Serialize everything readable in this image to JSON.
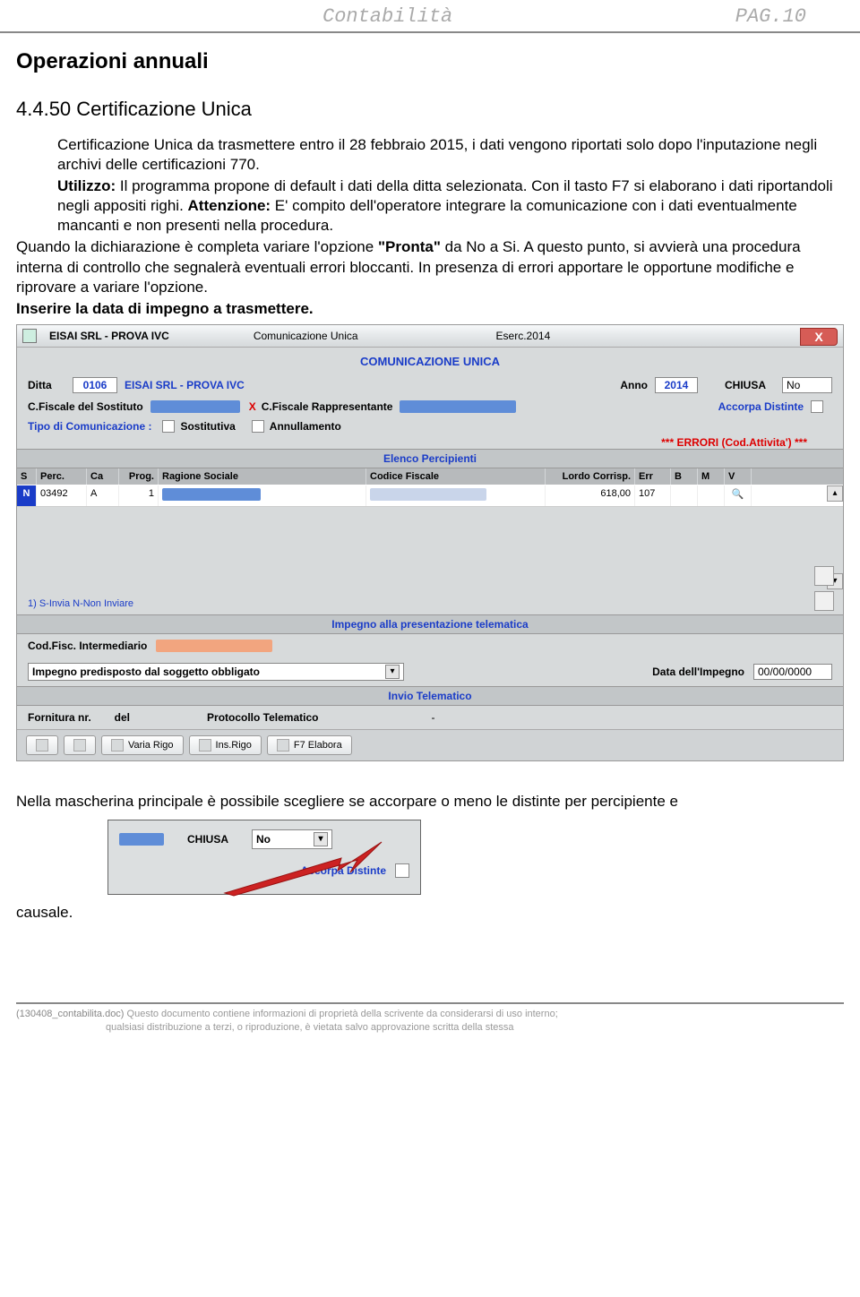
{
  "header": {
    "left": "Contabilità",
    "right": "PAG.10"
  },
  "h1": "Operazioni annuali",
  "h2": "4.4.50 Certificazione Unica",
  "para1": "Certificazione Unica da trasmettere entro il 28 febbraio 2015, i dati vengono riportati solo dopo l'inputazione negli archivi delle certificazioni 770.",
  "para2_a": "Utilizzo:",
  "para2_b": " Il programma propone di default i dati della ditta selezionata. Con il tasto F7 si elaborano i dati riportandoli negli appositi righi. ",
  "para2_c": "Attenzione:",
  "para2_d": " E' compito dell'operatore integrare la comunicazione con i dati eventualmente mancanti e non presenti nella procedura.",
  "para3_a": "Quando la dichiarazione è completa variare l'opzione ",
  "para3_b": "\"Pronta\"",
  "para3_c": " da No a Si. A questo punto, si avvierà una procedura interna di controllo che segnalerà eventuali errori bloccanti. In presenza di errori apportare le opportune modifiche e riprovare a variare l'opzione.",
  "para4": "Inserire la data di impegno a trasmettere.",
  "window": {
    "titlebar": {
      "company": "EISAI SRL - PROVA IVC",
      "center": "Comunicazione Unica",
      "eserc": "Eserc.2014"
    },
    "title": "COMUNICAZIONE UNICA",
    "ditta_label": "Ditta",
    "ditta_code": "0106",
    "ditta_name": "EISAI SRL - PROVA IVC",
    "anno_label": "Anno",
    "anno": "2014",
    "chiusa_label": "CHIUSA",
    "chiusa_val": "No",
    "cf_sost_label": "C.Fiscale del Sostituto",
    "cf_rapp_label": "C.Fiscale Rappresentante",
    "accorpa_label": "Accorpa Distinte",
    "tipo_label": "Tipo di Comunicazione :",
    "sostitutiva": "Sostitutiva",
    "annullamento": "Annullamento",
    "errori": "*** ERRORI (Cod.Attivita') ***",
    "elenco": "Elenco Percipienti",
    "cols": {
      "s": "S",
      "perc": "Perc.",
      "ca": "Ca",
      "prog": "Prog.",
      "rag": "Ragione Sociale",
      "cf": "Codice Fiscale",
      "lc": "Lordo Corrisp.",
      "err": "Err",
      "b": "B",
      "m": "M",
      "v": "V"
    },
    "row": {
      "s": "N",
      "perc": "03492",
      "ca": "A",
      "prog": "1",
      "lc": "618,00",
      "err": "107"
    },
    "hint": "1) S-Invia   N-Non Inviare",
    "impegno_header": "Impegno alla presentazione telematica",
    "codfisc_label": "Cod.Fisc. Intermediario",
    "impegno_combo": "Impegno predisposto dal soggetto obbligato",
    "data_impegno_label": "Data dell'Impegno",
    "data_impegno": "00/00/0000",
    "invio_header": "Invio Telematico",
    "fornitura_label": "Fornitura nr.",
    "del_label": "del",
    "protocollo_label": "Protocollo Telematico",
    "dash": "-",
    "buttons": {
      "b1": " ",
      "b2": " ",
      "b3": "Varia Rigo",
      "b4": "Ins.Rigo",
      "b5": "F7 Elabora"
    }
  },
  "after_text": "Nella mascherina principale è possibile scegliere se accorpare o meno le distinte per percipiente e",
  "mini": {
    "chiusa": "CHIUSA",
    "no": "No",
    "accorpa": "Accorpa Distinte"
  },
  "causale": "causale.",
  "footer": {
    "fname": "(130408_contabilita.doc)",
    "l1": " Questo documento contiene informazioni di proprietà della scrivente da considerarsi  di uso interno;",
    "l2": "qualsiasi distribuzione a terzi, o riproduzione, è vietata salvo approvazione scritta della stessa"
  }
}
